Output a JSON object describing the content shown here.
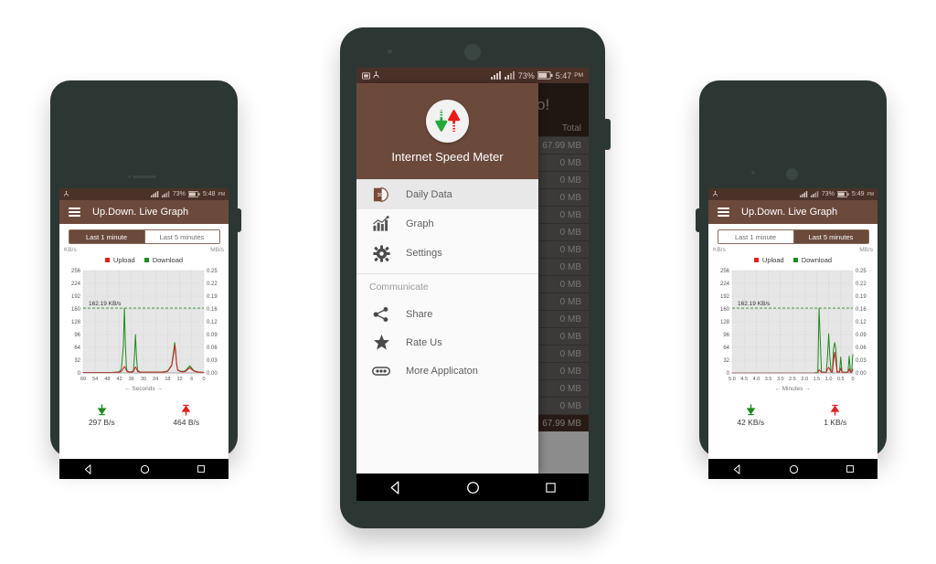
{
  "app": {
    "name": "Internet Speed Meter",
    "title": "Up.Down. Live Graph"
  },
  "phones": {
    "left": {
      "status": {
        "battery": "73%",
        "time": "5:48",
        "meridiem": "PM"
      },
      "appbar_title": "Up.Down. Live Graph",
      "tabs": [
        {
          "label": "Last 1 minute",
          "active": true
        },
        {
          "label": "Last 5 minutes",
          "active": false
        }
      ],
      "download_speed": "297 B/s",
      "upload_speed": "464 B/s"
    },
    "center": {
      "status": {
        "battery": "73%",
        "time": "5:47",
        "meridiem": "PM"
      },
      "background": {
        "pro_text": "Pro!",
        "column_header": "Total",
        "rows": [
          "67.99 MB",
          "0 MB",
          "0 MB",
          "0 MB",
          "0 MB",
          "0 MB",
          "0 MB",
          "0 MB",
          "0 MB",
          "0 MB",
          "0 MB",
          "0 MB",
          "0 MB",
          "0 MB",
          "0 MB",
          "0 MB"
        ],
        "total_row": "67.99 MB"
      },
      "drawer": {
        "title": "Internet Speed Meter",
        "items": [
          {
            "label": "Daily Data",
            "icon": "daily-data-icon",
            "selected": true
          },
          {
            "label": "Graph",
            "icon": "bar-chart-icon",
            "selected": false
          },
          {
            "label": "Settings",
            "icon": "gear-icon",
            "selected": false
          }
        ],
        "section_label": "Communicate",
        "communicate_items": [
          {
            "label": "Share",
            "icon": "share-icon"
          },
          {
            "label": "Rate Us",
            "icon": "star-icon"
          },
          {
            "label": "More Applicaton",
            "icon": "link-icon"
          }
        ]
      }
    },
    "right": {
      "status": {
        "battery": "73%",
        "time": "5:49",
        "meridiem": "PM"
      },
      "appbar_title": "Up.Down. Live Graph",
      "tabs": [
        {
          "label": "Last 1 minute",
          "active": false
        },
        {
          "label": "Last 5 minutes",
          "active": true
        }
      ],
      "download_speed": "42 KB/s",
      "upload_speed": "1 KB/s"
    }
  },
  "navbar": {
    "back": "back-icon",
    "home": "home-icon",
    "recents": "recents-icon"
  },
  "colors": {
    "brand_brown": "#6b4a3c",
    "status_brown": "#4a3229",
    "upload_red": "#e02020",
    "download_green": "#1e8a1e",
    "plot_bg": "#e6e6e6",
    "phone_body": "#2c3733"
  },
  "chart_data": [
    {
      "id": "left-chart",
      "type": "line",
      "title": "",
      "xlabel": "← Seconds →",
      "left_unit": "KB/s",
      "right_unit": "MB/s",
      "legend": [
        "Upload",
        "Download"
      ],
      "legend_position": "top-center",
      "grid": true,
      "x_ticks": [
        60,
        54,
        48,
        42,
        36,
        30,
        24,
        18,
        12,
        6,
        0
      ],
      "x_tick_labels": [
        "60",
        "54",
        "48",
        "42",
        "36",
        "30",
        "24",
        "18",
        "12",
        "6",
        "0"
      ],
      "xlim": [
        60,
        0
      ],
      "y_ticks_left": [
        0,
        32,
        64,
        96,
        128,
        160,
        192,
        224,
        256
      ],
      "y_tick_labels_left": [
        "0",
        "32",
        "64",
        "96",
        "128",
        "160",
        "192",
        "224",
        "256"
      ],
      "ylim_left": [
        0,
        256
      ],
      "y_ticks_right": [
        0.0,
        0.03,
        0.06,
        0.09,
        0.12,
        0.16,
        0.19,
        0.22,
        0.25
      ],
      "y_tick_labels_right": [
        "0.00",
        "0.03",
        "0.06",
        "0.09",
        "0.12",
        "0.16",
        "0.19",
        "0.22",
        "0.25"
      ],
      "ylim_right": [
        0.0,
        0.25
      ],
      "peak_annotation": "162.19 KB/s",
      "peak_value": 162.19,
      "series": [
        {
          "name": "Download",
          "color": "#1e8a1e",
          "x": [
            60,
            57,
            54,
            51,
            48,
            46,
            44,
            42,
            41,
            40,
            39.5,
            39,
            38.5,
            38,
            37,
            36,
            35,
            34.5,
            34,
            33.5,
            33,
            32,
            31,
            30,
            28,
            26,
            24,
            22,
            20,
            18,
            16,
            15,
            14.5,
            14,
            13.5,
            13,
            12,
            11,
            10,
            9,
            8,
            7,
            6,
            5,
            4,
            3,
            2,
            1,
            0
          ],
          "y": [
            1,
            1,
            1,
            1,
            1,
            1,
            2,
            3,
            10,
            70,
            162,
            70,
            12,
            4,
            3,
            3,
            5,
            40,
            96,
            42,
            8,
            3,
            2,
            2,
            2,
            2,
            2,
            2,
            3,
            5,
            20,
            55,
            76,
            55,
            22,
            8,
            5,
            4,
            4,
            6,
            12,
            18,
            12,
            6,
            4,
            3,
            2,
            2,
            1
          ]
        },
        {
          "name": "Upload",
          "color": "#cc1f1f",
          "x": [
            60,
            57,
            54,
            51,
            48,
            46,
            44,
            42,
            41,
            40,
            39.5,
            39,
            38.5,
            38,
            37,
            36,
            35,
            34.5,
            34,
            33.5,
            33,
            32,
            31,
            30,
            28,
            26,
            24,
            22,
            20,
            18,
            16,
            15,
            14.5,
            14,
            13.5,
            13,
            12,
            11,
            10,
            9,
            8,
            7,
            6,
            5,
            4,
            3,
            2,
            1,
            0
          ],
          "y": [
            1,
            1,
            1,
            1,
            1,
            1,
            1,
            2,
            4,
            12,
            16,
            13,
            6,
            3,
            2,
            2,
            3,
            10,
            15,
            11,
            4,
            2,
            2,
            2,
            2,
            2,
            2,
            2,
            2,
            4,
            18,
            48,
            69,
            50,
            20,
            7,
            4,
            3,
            3,
            4,
            9,
            13,
            9,
            5,
            3,
            2,
            2,
            2,
            1
          ]
        }
      ]
    },
    {
      "id": "right-chart",
      "type": "line",
      "title": "",
      "xlabel": "← Minutes →",
      "left_unit": "KB/s",
      "right_unit": "MB/s",
      "legend": [
        "Upload",
        "Download"
      ],
      "legend_position": "top-center",
      "grid": true,
      "x_ticks": [
        5.0,
        4.5,
        4.0,
        3.5,
        3.0,
        2.5,
        2.0,
        1.5,
        1.0,
        0.5,
        0
      ],
      "x_tick_labels": [
        "5.0",
        "4.5",
        "4.0",
        "3.5",
        "3.0",
        "2.5",
        "2.0",
        "1.5",
        "1.0",
        "0.5",
        "0"
      ],
      "xlim": [
        5.0,
        0
      ],
      "y_ticks_left": [
        0,
        32,
        64,
        96,
        128,
        160,
        192,
        224,
        256
      ],
      "y_tick_labels_left": [
        "0",
        "32",
        "64",
        "96",
        "128",
        "160",
        "192",
        "224",
        "256"
      ],
      "ylim_left": [
        0,
        256
      ],
      "y_ticks_right": [
        0.0,
        0.03,
        0.06,
        0.09,
        0.12,
        0.16,
        0.19,
        0.22,
        0.25
      ],
      "y_tick_labels_right": [
        "0.00",
        "0.03",
        "0.06",
        "0.09",
        "0.12",
        "0.16",
        "0.19",
        "0.22",
        "0.25"
      ],
      "ylim_right": [
        0.0,
        0.25
      ],
      "peak_annotation": "162.19 KB/s",
      "peak_value": 162.19,
      "series": [
        {
          "name": "Download",
          "color": "#1e8a1e",
          "x": [
            5.0,
            4.5,
            4.0,
            3.5,
            3.0,
            2.5,
            2.0,
            1.6,
            1.45,
            1.4,
            1.3,
            1.2,
            1.1,
            1.05,
            1.0,
            0.95,
            0.9,
            0.85,
            0.8,
            0.75,
            0.7,
            0.65,
            0.6,
            0.55,
            0.5,
            0.45,
            0.4,
            0.35,
            0.3,
            0.25,
            0.2,
            0.15,
            0.1,
            0.05,
            0.0
          ],
          "y": [
            0,
            0,
            0,
            0,
            0,
            0,
            0,
            0,
            2,
            162,
            3,
            2,
            2,
            40,
            98,
            38,
            3,
            2,
            60,
            76,
            58,
            4,
            3,
            3,
            40,
            3,
            2,
            2,
            2,
            2,
            3,
            42,
            3,
            2,
            46
          ]
        },
        {
          "name": "Upload",
          "color": "#cc1f1f",
          "x": [
            5.0,
            4.5,
            4.0,
            3.5,
            3.0,
            2.5,
            2.0,
            1.6,
            1.45,
            1.4,
            1.3,
            1.2,
            1.1,
            1.05,
            1.0,
            0.95,
            0.9,
            0.85,
            0.8,
            0.75,
            0.7,
            0.65,
            0.6,
            0.55,
            0.5,
            0.45,
            0.4,
            0.35,
            0.3,
            0.25,
            0.2,
            0.15,
            0.1,
            0.05,
            0.0
          ],
          "y": [
            0,
            0,
            0,
            0,
            0,
            0,
            0,
            0,
            1,
            8,
            2,
            1,
            1,
            10,
            14,
            9,
            2,
            1,
            30,
            52,
            28,
            2,
            2,
            2,
            12,
            2,
            1,
            1,
            1,
            1,
            2,
            10,
            2,
            1,
            9
          ]
        }
      ]
    }
  ]
}
